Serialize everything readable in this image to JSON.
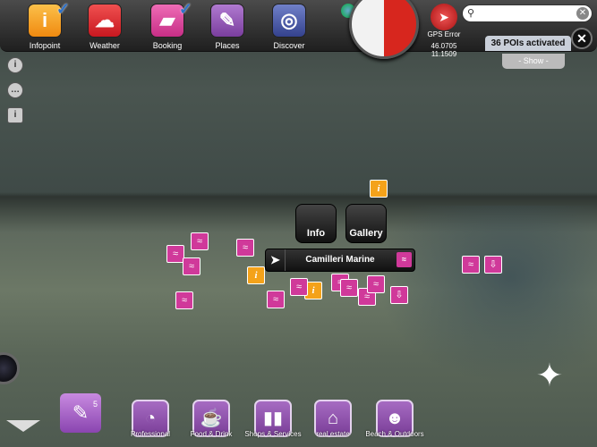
{
  "toolbar": {
    "items": [
      {
        "label": "Infopoint",
        "icon": "info-icon",
        "color": "#f4a21a",
        "checked": true
      },
      {
        "label": "Weather",
        "icon": "weather-icon",
        "color": "#e0262e",
        "checked": false
      },
      {
        "label": "Booking",
        "icon": "suitcase-icon",
        "color": "#d83f98",
        "checked": true
      },
      {
        "label": "Places",
        "icon": "pushpin-icon",
        "color": "#8a4fb0",
        "checked": false
      },
      {
        "label": "Discover",
        "icon": "compass-icon",
        "color": "#4a5aa8",
        "checked": false
      }
    ]
  },
  "gps": {
    "status": "GPS Error",
    "lat": "46.0705",
    "lon": "11.1509"
  },
  "search": {
    "placeholder": "",
    "value": ""
  },
  "pois": {
    "activated": "36 POIs activated",
    "show": "- Show -"
  },
  "popup": {
    "info": "Info",
    "gallery": "Gallery",
    "name": "Camilleri Marine"
  },
  "places": {
    "badge": "5"
  },
  "categories": [
    {
      "label": "Professional"
    },
    {
      "label": "Food & Drink"
    },
    {
      "label": "Shops & Services"
    },
    {
      "label": "real estate"
    },
    {
      "label": "Beach & Outdoors"
    }
  ]
}
